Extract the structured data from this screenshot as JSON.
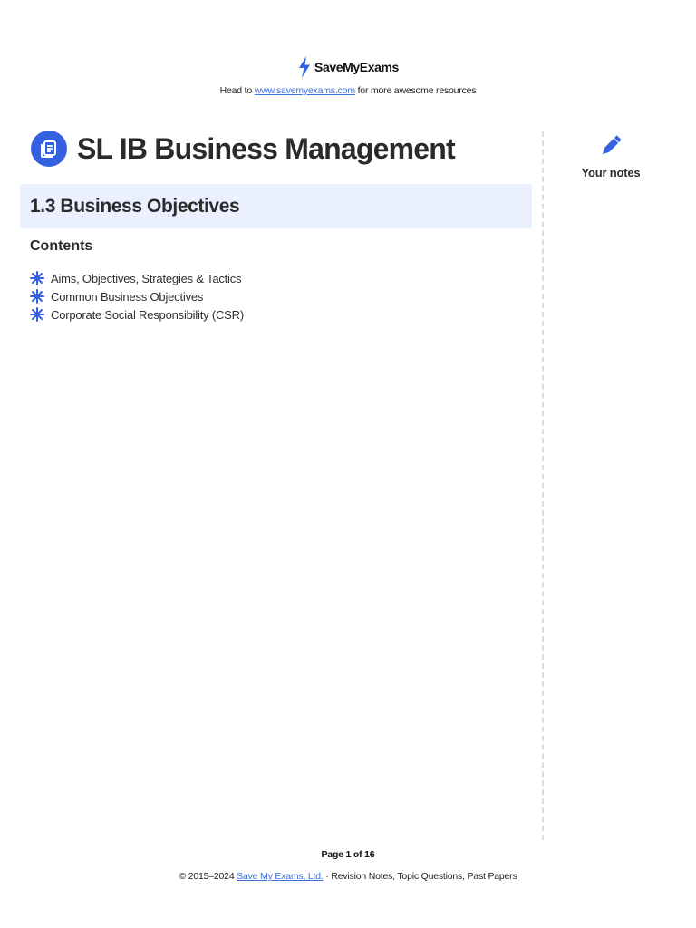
{
  "header": {
    "brand_name": "SaveMyExams",
    "tagline_prefix": "Head to",
    "tagline_link": "www.savemyexams.com",
    "tagline_suffix": "for more awesome resources"
  },
  "document": {
    "title": "SL IB Business Management",
    "section_title": "1.3 Business Objectives",
    "contents_heading": "Contents",
    "contents": [
      "Aims, Objectives, Strategies & Tactics",
      "Common Business Objectives",
      "Corporate Social Responsibility (CSR)"
    ]
  },
  "sidebar": {
    "notes_label": "Your notes"
  },
  "footer": {
    "page_label": "Page 1 of 16",
    "copyright_prefix": "© 2015–2024",
    "copyright_link": "Save My Exams, Ltd.",
    "copyright_suffix": "· Revision Notes, Topic Questions, Past Papers"
  },
  "colors": {
    "accent": "#3560e0",
    "link": "#3b6fe0",
    "section_band": "#eaf0fd"
  },
  "icons": {
    "brand": "lightning-bolt-icon",
    "title": "document-lines-icon",
    "bullet": "asterisk-star-icon",
    "notes": "pencil-icon"
  }
}
